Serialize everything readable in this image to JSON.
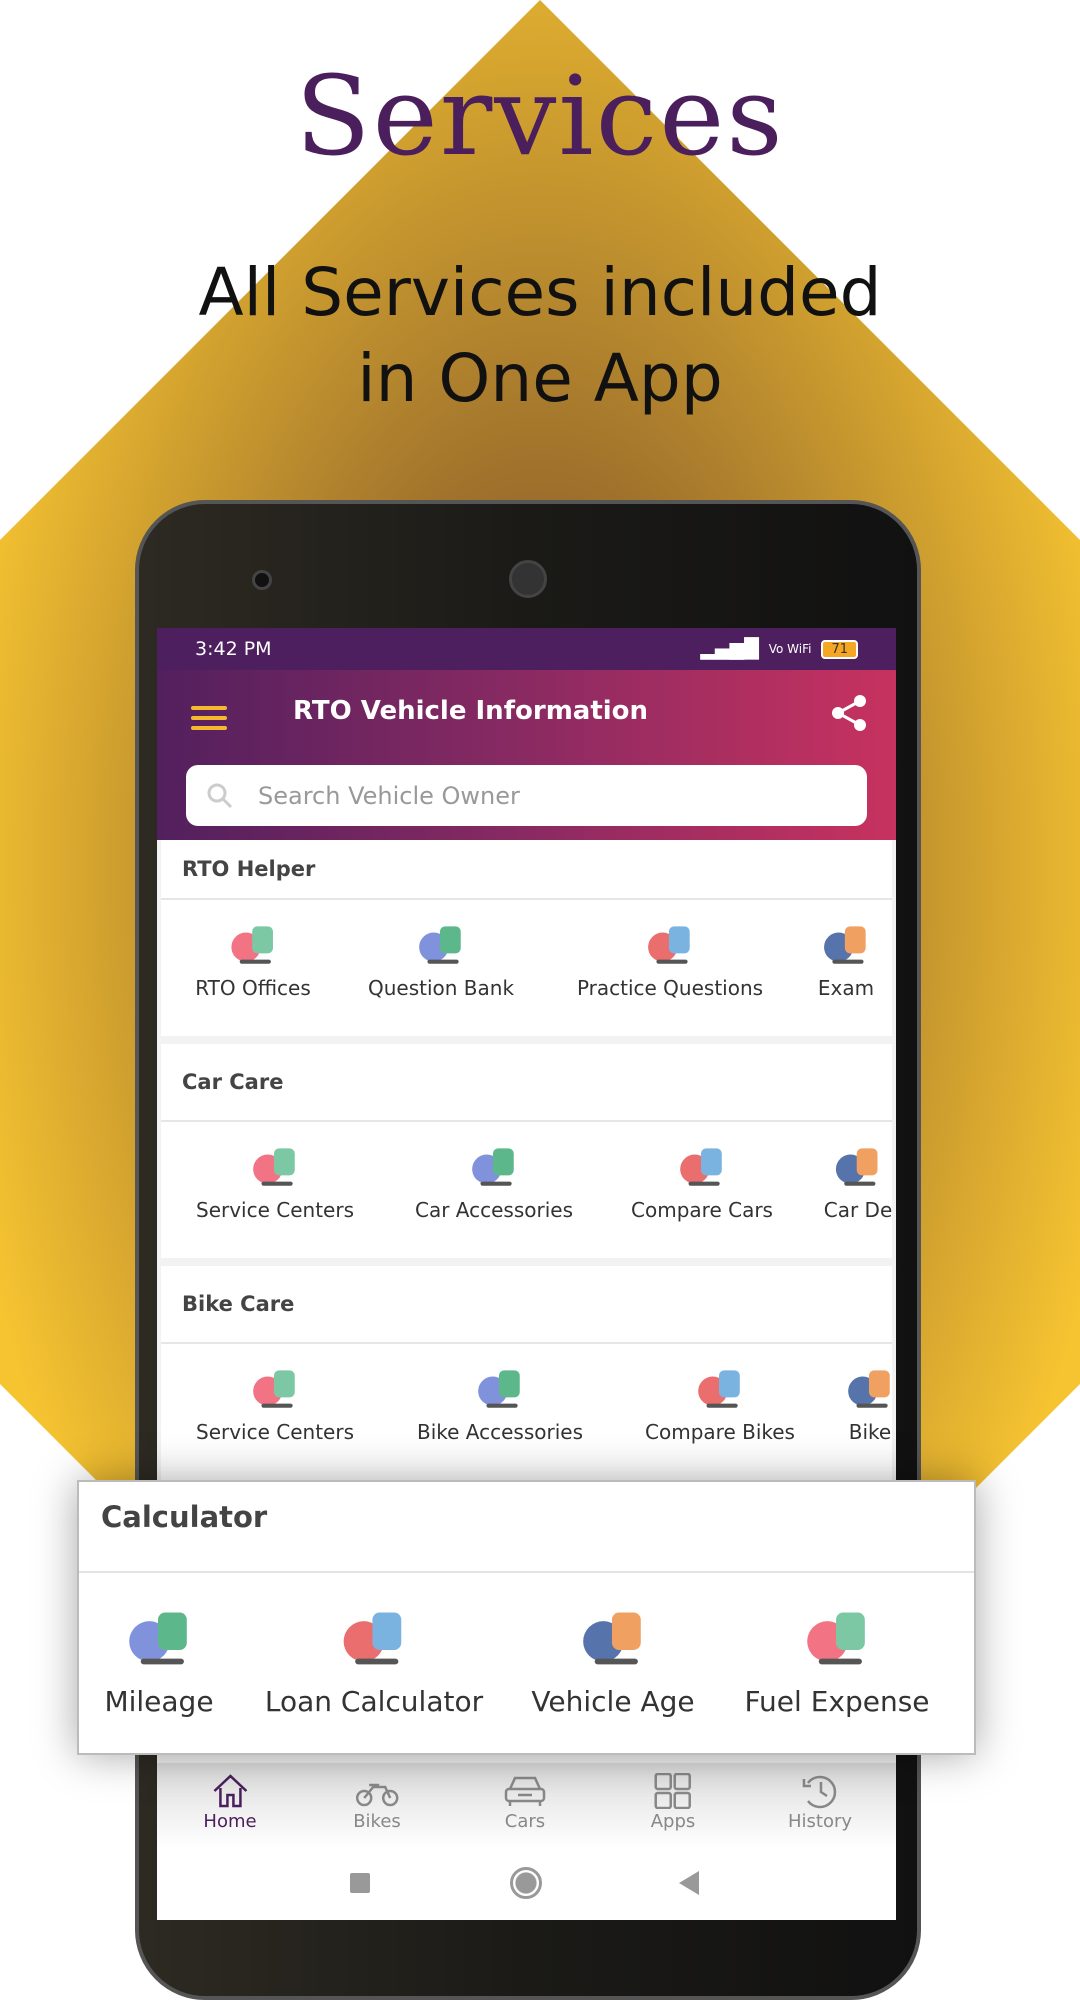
{
  "hero": {
    "title": "Services",
    "subtitle_line1": "All Services included",
    "subtitle_line2": "in One App"
  },
  "colors": {
    "accent_yellow": "#f6c431",
    "title_purple": "#4a1f5c",
    "header_start": "#52205e",
    "header_end": "#c7325f"
  },
  "status_bar": {
    "time": "3:42 PM",
    "network": "Vo WiFi",
    "battery": "71"
  },
  "app_bar": {
    "title": "RTO Vehicle Information",
    "menu_icon": "hamburger-icon",
    "share_icon": "share-icon"
  },
  "search": {
    "placeholder": "Search Vehicle Owner",
    "value": ""
  },
  "sections": [
    {
      "title": "RTO Helper",
      "items": [
        {
          "label": "RTO Offices",
          "icon": "map-pin-icon"
        },
        {
          "label": "Question Bank",
          "icon": "question-chat-icon"
        },
        {
          "label": "Practice Questions",
          "icon": "presentation-icon"
        },
        {
          "label": "Exam",
          "icon": "exam-icon"
        }
      ]
    },
    {
      "title": "Car Care",
      "items": [
        {
          "label": "Service Centers",
          "icon": "mechanic-icon"
        },
        {
          "label": "Car Accessories",
          "icon": "accessory-icon"
        },
        {
          "label": "Compare Cars",
          "icon": "scale-icon"
        },
        {
          "label": "Car De",
          "icon": "dealer-icon"
        }
      ]
    },
    {
      "title": "Bike Care",
      "items": [
        {
          "label": "Service Centers",
          "icon": "handlebar-icon"
        },
        {
          "label": "Bike Accessories",
          "icon": "helmet-icon"
        },
        {
          "label": "Compare Bikes",
          "icon": "scale-icon"
        },
        {
          "label": "Bike",
          "icon": "bike-icon"
        }
      ]
    }
  ],
  "calculator": {
    "title": "Calculator",
    "items": [
      {
        "label": "Mileage",
        "icon": "calculator-icon"
      },
      {
        "label": "Loan Calculator",
        "icon": "loan-calculator-icon"
      },
      {
        "label": "Vehicle Age",
        "icon": "document-calculator-icon"
      },
      {
        "label": "Fuel Expense",
        "icon": "calendar-add-icon"
      }
    ]
  },
  "bottom_nav": [
    {
      "label": "Home",
      "active": true
    },
    {
      "label": "Bikes"
    },
    {
      "label": "Cars"
    },
    {
      "label": "Apps"
    },
    {
      "label": "History"
    }
  ]
}
